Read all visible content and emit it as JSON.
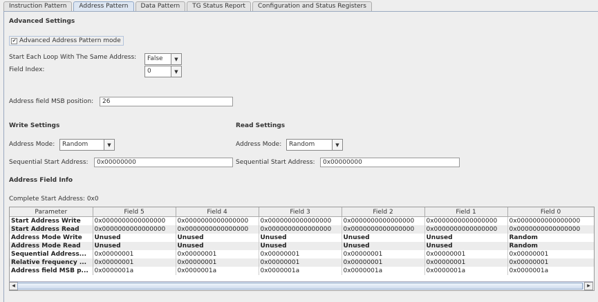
{
  "tabs": [
    "Instruction Pattern",
    "Address Pattern",
    "Data Pattern",
    "TG Status Report",
    "Configuration and Status Registers"
  ],
  "active_tab": "Address Pattern",
  "advanced": {
    "title": "Advanced Settings",
    "mode_label": "Advanced Address Pattern mode",
    "mode_checked": true,
    "same_address_label": "Start Each Loop With The Same Address:",
    "same_address_value": "False",
    "field_index_label": "Field Index:",
    "field_index_value": "0",
    "msb_label": "Address field MSB position:",
    "msb_value": "26"
  },
  "write": {
    "title": "Write Settings",
    "mode_label": "Address Mode:",
    "mode_value": "Random",
    "start_label": "Sequential Start Address:",
    "start_value": "0x00000000"
  },
  "read": {
    "title": "Read Settings",
    "mode_label": "Address Mode:",
    "mode_value": "Random",
    "start_label": "Sequential Start Address:",
    "start_value": "0x00000000"
  },
  "field_info": {
    "title": "Address Field Info",
    "complete": "Complete Start Address: 0x0"
  },
  "table": {
    "headers": [
      "Parameter",
      "Field 5",
      "Field 4",
      "Field 3",
      "Field 2",
      "Field 1",
      "Field 0"
    ],
    "rows": [
      [
        "Start Address Write",
        "0x0000000000000000",
        "0x0000000000000000",
        "0x0000000000000000",
        "0x0000000000000000",
        "0x0000000000000000",
        "0x0000000000000000"
      ],
      [
        "Start Address Read",
        "0x0000000000000000",
        "0x0000000000000000",
        "0x0000000000000000",
        "0x0000000000000000",
        "0x0000000000000000",
        "0x0000000000000000"
      ],
      [
        "Address Mode Write",
        "Unused",
        "Unused",
        "Unused",
        "Unused",
        "Unused",
        "Random"
      ],
      [
        "Address Mode Read",
        "Unused",
        "Unused",
        "Unused",
        "Unused",
        "Unused",
        "Random"
      ],
      [
        "Sequential Address...",
        "0x00000001",
        "0x00000001",
        "0x00000001",
        "0x00000001",
        "0x00000001",
        "0x00000001"
      ],
      [
        "Relative frequency ...",
        "0x00000001",
        "0x00000001",
        "0x00000001",
        "0x00000001",
        "0x00000001",
        "0x00000001"
      ],
      [
        "Address field MSB p...",
        "0x0000001a",
        "0x0000001a",
        "0x0000001a",
        "0x0000001a",
        "0x0000001a",
        "0x0000001a"
      ]
    ]
  }
}
